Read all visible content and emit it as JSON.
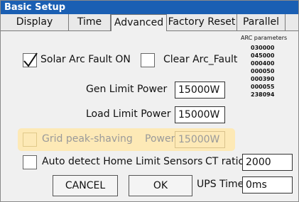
{
  "window": {
    "title": "Basic Setup"
  },
  "tabs": [
    {
      "label": "Display"
    },
    {
      "label": "Time"
    },
    {
      "label": "Advanced"
    },
    {
      "label": "Factory Reset"
    },
    {
      "label": "Parallel"
    }
  ],
  "active_tab": "Advanced",
  "solar_arc_fault": {
    "label": "Solar Arc Fault ON",
    "checked": true
  },
  "clear_arc_fault": {
    "label": "Clear Arc_Fault",
    "checked": false
  },
  "arc_parameters": {
    "title": "ARC parameters",
    "values": [
      "030000",
      "045000",
      "000400",
      "000050",
      "000390",
      "000055",
      "238094"
    ]
  },
  "gen_limit_power": {
    "label": "Gen Limit Power",
    "value": "15000W"
  },
  "load_limit_power": {
    "label": "Load Limit Power",
    "value": "15000W"
  },
  "grid_peak_shaving": {
    "label": "Grid peak-shaving",
    "power_label": "Power",
    "value": "15000W",
    "checked": false,
    "highlight_color": "#fde9b6"
  },
  "auto_detect": {
    "label": "Auto detect Home Limit Sensors",
    "checked": false
  },
  "ct_ratio": {
    "label": "CT ratio",
    "value": "2000"
  },
  "ups_time": {
    "label": "UPS Time",
    "value": "0ms"
  },
  "buttons": {
    "cancel": "CANCEL",
    "ok": "OK"
  },
  "colors": {
    "titlebar": "#1a5fb3",
    "highlight": "#fde9b6"
  }
}
